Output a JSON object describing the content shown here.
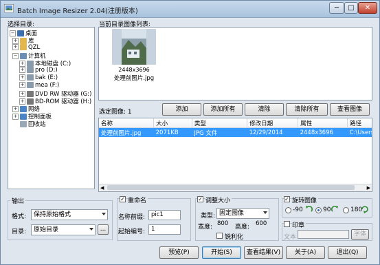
{
  "window": {
    "title": "Batch Image Resizer 2.04(注册版本)",
    "min": "─",
    "max": "□",
    "close": "✕"
  },
  "labels": {
    "select_dir": "选择目录:",
    "current_list": "当前目录图像列表:",
    "selected_count": "选定图像: 1",
    "output": "输出"
  },
  "tree": [
    {
      "label": "桌面",
      "exp": "−",
      "color": "#3a6fb0"
    },
    {
      "label": "库",
      "exp": "+",
      "color": "#e3b74b"
    },
    {
      "label": "QZL",
      "exp": "+",
      "color": "#e3b74b"
    },
    {
      "label": "计算机",
      "exp": "−",
      "color": "#6c8fb5"
    },
    {
      "label": "本地磁盘 (C:)",
      "exp": "+",
      "color": "#8a9bab"
    },
    {
      "label": "pro (D:)",
      "exp": "+",
      "color": "#8a9bab"
    },
    {
      "label": "bak (E:)",
      "exp": "+",
      "color": "#8a9bab"
    },
    {
      "label": "mea (F:)",
      "exp": "+",
      "color": "#8a9bab"
    },
    {
      "label": "DVD RW 驱动器 (G:)",
      "exp": "+",
      "color": "#777"
    },
    {
      "label": "BD-ROM 驱动器 (H:)",
      "exp": "+",
      "color": "#777"
    },
    {
      "label": "网络",
      "exp": "+",
      "color": "#4a86c7"
    },
    {
      "label": "控制面板",
      "exp": "+",
      "color": "#4a86c7"
    },
    {
      "label": "回收站",
      "exp": "",
      "color": "#9aa8b6"
    }
  ],
  "thumbnail": {
    "dims": "2448x3696",
    "name": "处理前图片.jpg"
  },
  "actions": {
    "add": "添加",
    "add_all": "添加所有",
    "clear": "清除",
    "clear_all": "清除所有",
    "view_image": "查看图像"
  },
  "table": {
    "headers": [
      "名称",
      "大小",
      "类型",
      "修改日期",
      "属性",
      "路径"
    ],
    "rows": [
      [
        "处理前图片.jpg",
        "2071KB",
        "JPG 文件",
        "12/29/2014",
        "2448x3696",
        "C:\\Users\\"
      ]
    ]
  },
  "output": {
    "format_label": "格式:",
    "format_value": "保持原始格式",
    "dir_label": "目录:",
    "dir_value": "原始目录",
    "browse": "..."
  },
  "rename": {
    "label": "重命名",
    "checked": "✓",
    "prefix_label": "名称前缀:",
    "prefix_value": "pic1",
    "start_label": "起始编号:",
    "start_value": "1"
  },
  "resize": {
    "label": "调整大小",
    "checked": "✓",
    "type_label": "类型:",
    "type_value": "固定图像",
    "width_label": "宽度:",
    "width_value": "800",
    "height_label": "高度:",
    "height_value": "600",
    "sharpen_label": "锐利化"
  },
  "rotate": {
    "label": "旋转图像",
    "checked": "✓",
    "opt_m90": "-90",
    "opt_90": "90",
    "opt_180": "180"
  },
  "watermark": {
    "label": "印章",
    "text_label": "文本",
    "font_btn": "字体"
  },
  "bottom": {
    "preview": "预览(P)",
    "start": "开始(S)",
    "view_result": "查看结果(V)",
    "about": "关于(A)",
    "exit": "退出(Q)"
  }
}
